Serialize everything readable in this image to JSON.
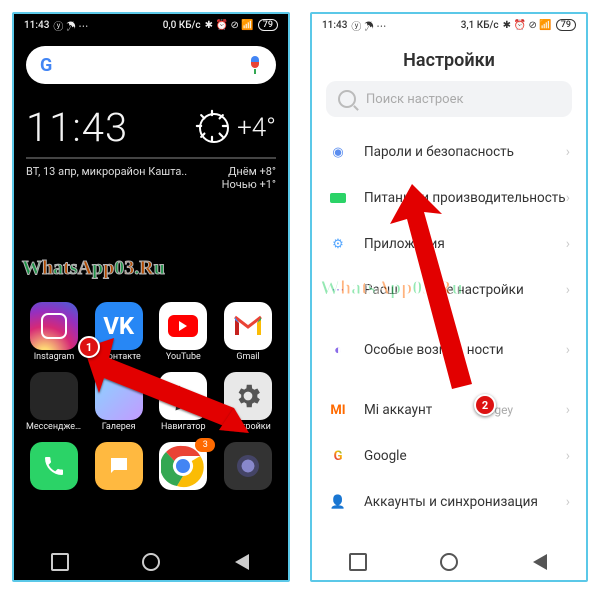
{
  "statusbar": {
    "time": "11:43",
    "net_left": "0,0 КБ/с",
    "net_right": "3,1 КБ/с",
    "battery": "79"
  },
  "home": {
    "clock": "11:43",
    "temp": "+4°",
    "date": "ВТ, 13 апр, микрорайон Кашта..",
    "forecast_day": "Днём +8°",
    "forecast_night": "Ночью +1°",
    "apps": {
      "instagram": "Instagram",
      "vk": "ВКонтакте",
      "youtube": "YouTube",
      "gmail": "Gmail",
      "messengers": "Мессенджеры",
      "gallery": "Галерея",
      "navigator": "Навигатор",
      "settings": "Настройки"
    },
    "badge3": "3"
  },
  "settings": {
    "title": "Настройки",
    "search_placeholder": "Поиск настроек",
    "items": {
      "security": "Пароли и безопасность",
      "battery": "Питание и производительность",
      "apps": "Приложения",
      "advanced_a": "Расш",
      "advanced_b": "е настройки",
      "accessibility_a": "Особые возм",
      "accessibility_b": "ности",
      "mi_account": "Mi аккаунт",
      "mi_user": "Sergey",
      "google": "Google",
      "sync": "Аккаунты и синхронизация"
    }
  },
  "callouts": {
    "one": "1",
    "two": "2"
  },
  "watermark": "WhatsApp03.Ru"
}
